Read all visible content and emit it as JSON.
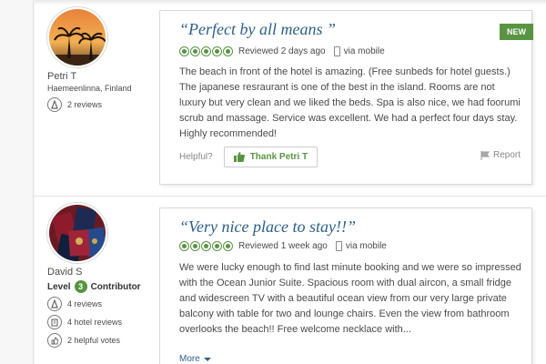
{
  "reviews": [
    {
      "user": {
        "name": "Petri T",
        "location": "Haemeenlinna, Finland",
        "stats": [
          {
            "icon": "reviews-icon",
            "text": "2 reviews"
          }
        ]
      },
      "is_new": true,
      "new_label": "NEW",
      "title": "“Perfect by all means ”",
      "rating": 5,
      "date": "Reviewed 2 days ago",
      "device": "via mobile",
      "body": "The beach in front of the hotel is amazing. (Free sunbeds for hotel guests.) The japanese resraurant is one of the best in the island. Rooms are not luxury but very clean and we liked the beds. Spa is also nice, we had foorumi scrub and massage. Service was excellent. We had a perfect four days stay. Highly recommended!",
      "helpful_label": "Helpful?",
      "thank_label": "Thank Petri T",
      "report_label": "Report"
    },
    {
      "user": {
        "name": "David S",
        "level_word": "Level",
        "level_num": "3",
        "level_title": "Contributor",
        "stats": [
          {
            "icon": "reviews-icon",
            "text": "4 reviews"
          },
          {
            "icon": "hotel-reviews-icon",
            "text": "4 hotel reviews"
          },
          {
            "icon": "helpful-votes-icon",
            "text": "2 helpful votes"
          }
        ]
      },
      "title": "“Very nice place to stay!!”",
      "rating": 5,
      "date": "Reviewed 1 week ago",
      "device": "via mobile",
      "body": "We were lucky enough to find last minute booking and we were so impressed with the Ocean Junior Suite. Spacious room with dual aircon, a small fridge and widescreen TV with a beautiful ocean view from our very large private balcony with table for two and lounge chairs. Even the view from bathroom overlooks the beach!! Free welcome necklace with...",
      "more_label": "More"
    }
  ],
  "colors": {
    "accent_green": "#589442",
    "title_blue": "#2d5f8c"
  }
}
